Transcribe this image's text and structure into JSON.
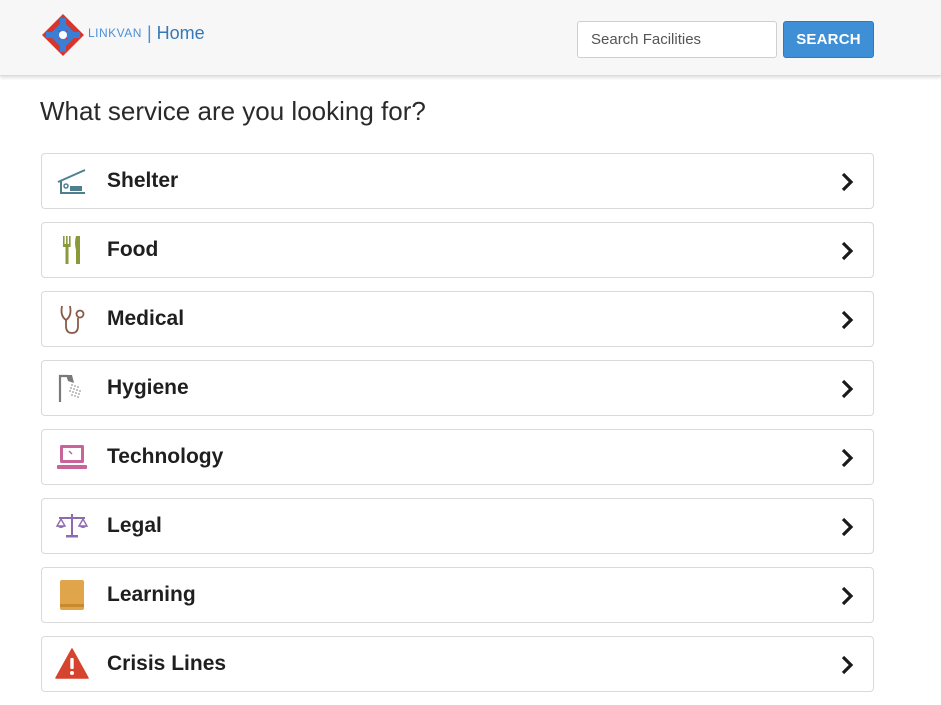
{
  "header": {
    "brand_name": "LINKVAN",
    "separator": "|",
    "home_label": "Home",
    "search_placeholder": "Search Facilities",
    "search_button": "SEARCH"
  },
  "page": {
    "title": "What service are you looking for?"
  },
  "services": [
    {
      "label": "Shelter",
      "icon": "shelter-icon",
      "color": "#4f7f8f"
    },
    {
      "label": "Food",
      "icon": "fork-knife-icon",
      "color": "#8a9a3a"
    },
    {
      "label": "Medical",
      "icon": "stethoscope-icon",
      "color": "#8a5a46"
    },
    {
      "label": "Hygiene",
      "icon": "shower-icon",
      "color": "#7a7a7a"
    },
    {
      "label": "Technology",
      "icon": "laptop-icon",
      "color": "#c9649a"
    },
    {
      "label": "Legal",
      "icon": "scales-icon",
      "color": "#8e6bb0"
    },
    {
      "label": "Learning",
      "icon": "book-icon",
      "color": "#e0a54a"
    },
    {
      "label": "Crisis Lines",
      "icon": "warning-icon",
      "color": "#d6432e"
    }
  ],
  "colors": {
    "accent": "#3f8fd6",
    "navbar_bg": "#f7f7f7"
  }
}
